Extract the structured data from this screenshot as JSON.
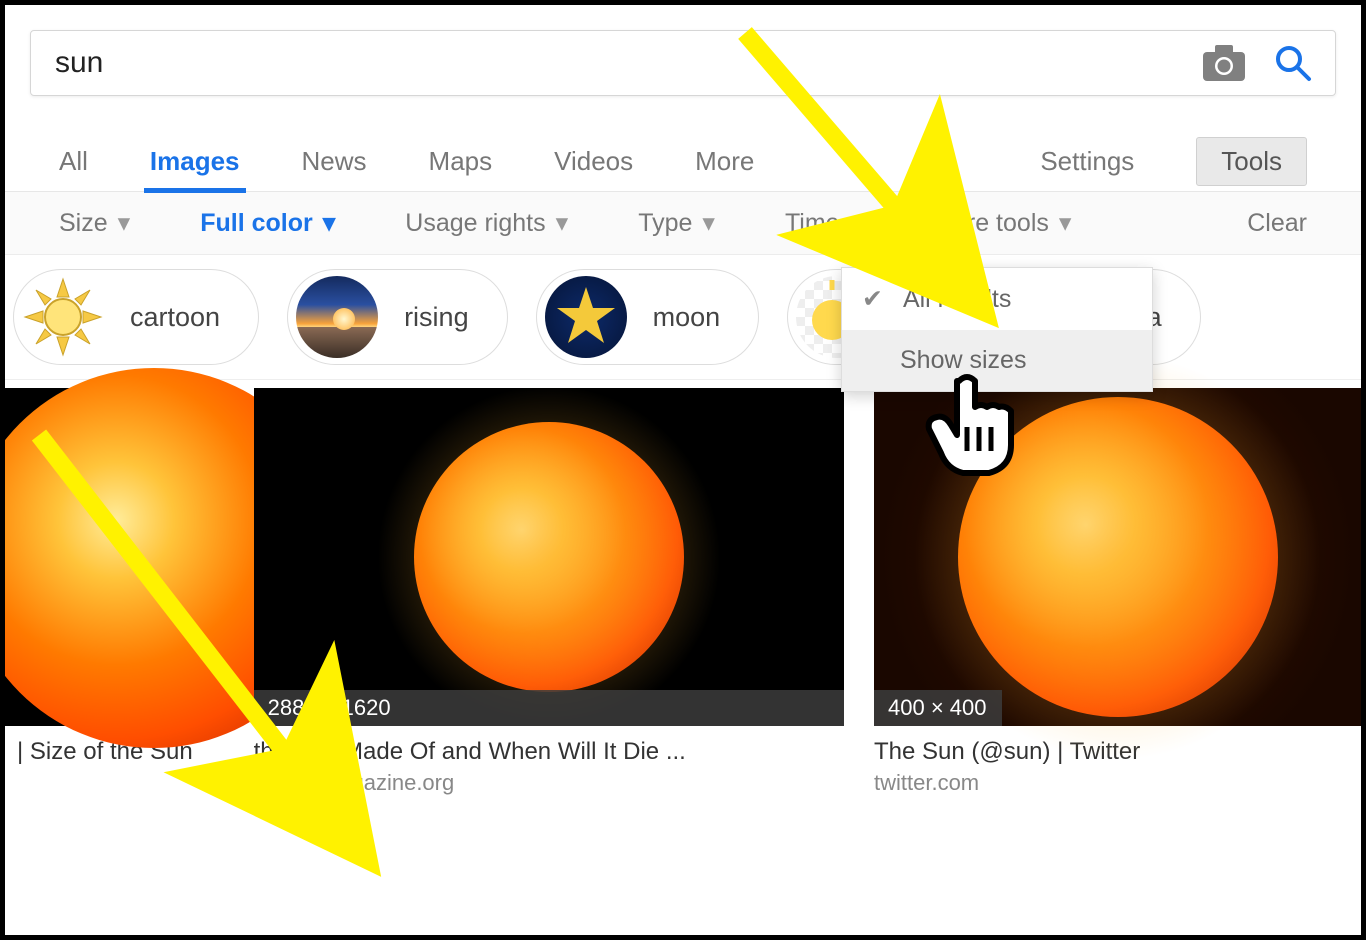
{
  "search": {
    "query": "sun"
  },
  "tabs": {
    "all": "All",
    "images": "Images",
    "news": "News",
    "maps": "Maps",
    "videos": "Videos",
    "more": "More",
    "settings": "Settings",
    "tools": "Tools",
    "active": "images"
  },
  "filters": {
    "size": "Size",
    "color": "Full color",
    "rights": "Usage rights",
    "type": "Type",
    "time": "Time",
    "more_tools": "More tools",
    "clear": "Clear"
  },
  "more_tools_menu": {
    "all_results": "All results",
    "show_sizes": "Show sizes",
    "selected": "all_results",
    "hovered": "show_sizes"
  },
  "chips": [
    {
      "label": "cartoon"
    },
    {
      "label": "rising"
    },
    {
      "label": "moon"
    },
    {
      "label": ""
    },
    {
      "label": "anima"
    }
  ],
  "results": [
    {
      "title": "| Size of the Sun",
      "domain": "",
      "size_label": ""
    },
    {
      "title": "the Sun Made Of and When Will It Die ...",
      "domain": "quantamagazine.org",
      "size_label": "2880 × 1620"
    },
    {
      "title": "The Sun (@sun) | Twitter",
      "domain": "twitter.com",
      "size_label": "400 × 400"
    }
  ],
  "colors": {
    "accent": "#1a73e8",
    "arrow": "#fff200"
  }
}
